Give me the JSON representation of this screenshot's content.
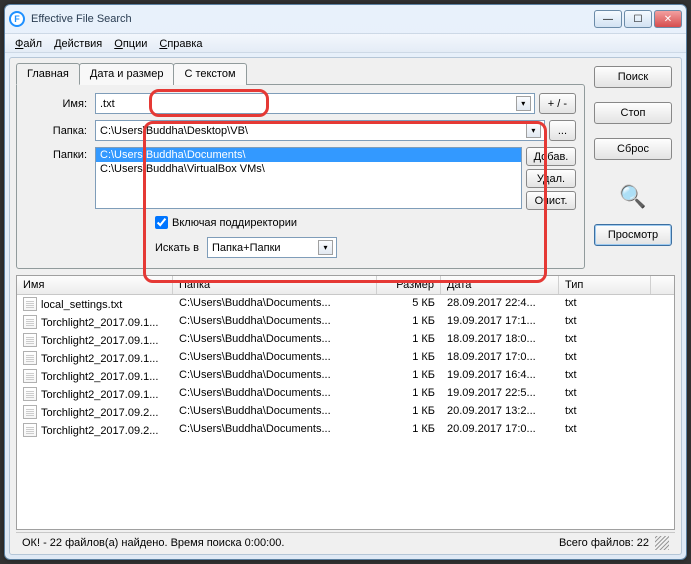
{
  "window": {
    "title": "Effective File Search"
  },
  "menu": {
    "file": "Файл",
    "actions": "Действия",
    "options": "Опции",
    "help": "Справка"
  },
  "tabs": {
    "main": "Главная",
    "date": "Дата и размер",
    "text": "С текстом"
  },
  "labels": {
    "name": "Имя:",
    "folder": "Папка:",
    "folders": "Папки:",
    "searchIn": "Искать в"
  },
  "fields": {
    "name": ".txt",
    "folder": "C:\\Users\\Buddha\\Desktop\\VB\\",
    "folderList": [
      "C:\\Users\\Buddha\\Documents\\",
      "C:\\Users\\Buddha\\VirtualBox VMs\\"
    ],
    "subdirs": "Включая поддиректории",
    "searchIn": "Папка+Папки"
  },
  "btns": {
    "plusMinus": "+ / -",
    "browse": "...",
    "add": "Добав.",
    "del": "Удал.",
    "clear": "Очист.",
    "search": "Поиск",
    "stop": "Стоп",
    "reset": "Сброс",
    "preview": "Просмотр"
  },
  "gridHeaders": {
    "name": "Имя",
    "folder": "Папка",
    "size": "Размер",
    "date": "Дата",
    "type": "Тип"
  },
  "rows": [
    {
      "name": "local_settings.txt",
      "folder": "C:\\Users\\Buddha\\Documents...",
      "size": "5 КБ",
      "date": "28.09.2017 22:4...",
      "type": "txt"
    },
    {
      "name": "Torchlight2_2017.09.1...",
      "folder": "C:\\Users\\Buddha\\Documents...",
      "size": "1 КБ",
      "date": "19.09.2017 17:1...",
      "type": "txt"
    },
    {
      "name": "Torchlight2_2017.09.1...",
      "folder": "C:\\Users\\Buddha\\Documents...",
      "size": "1 КБ",
      "date": "18.09.2017 18:0...",
      "type": "txt"
    },
    {
      "name": "Torchlight2_2017.09.1...",
      "folder": "C:\\Users\\Buddha\\Documents...",
      "size": "1 КБ",
      "date": "18.09.2017 17:0...",
      "type": "txt"
    },
    {
      "name": "Torchlight2_2017.09.1...",
      "folder": "C:\\Users\\Buddha\\Documents...",
      "size": "1 КБ",
      "date": "19.09.2017 16:4...",
      "type": "txt"
    },
    {
      "name": "Torchlight2_2017.09.1...",
      "folder": "C:\\Users\\Buddha\\Documents...",
      "size": "1 КБ",
      "date": "19.09.2017 22:5...",
      "type": "txt"
    },
    {
      "name": "Torchlight2_2017.09.2...",
      "folder": "C:\\Users\\Buddha\\Documents...",
      "size": "1 КБ",
      "date": "20.09.2017 13:2...",
      "type": "txt"
    },
    {
      "name": "Torchlight2_2017.09.2...",
      "folder": "C:\\Users\\Buddha\\Documents...",
      "size": "1 КБ",
      "date": "20.09.2017 17:0...",
      "type": "txt"
    }
  ],
  "status": {
    "left": "ОК! - 22 файлов(а) найдено. Время поиска 0:00:00.",
    "right": "Всего файлов: 22"
  }
}
